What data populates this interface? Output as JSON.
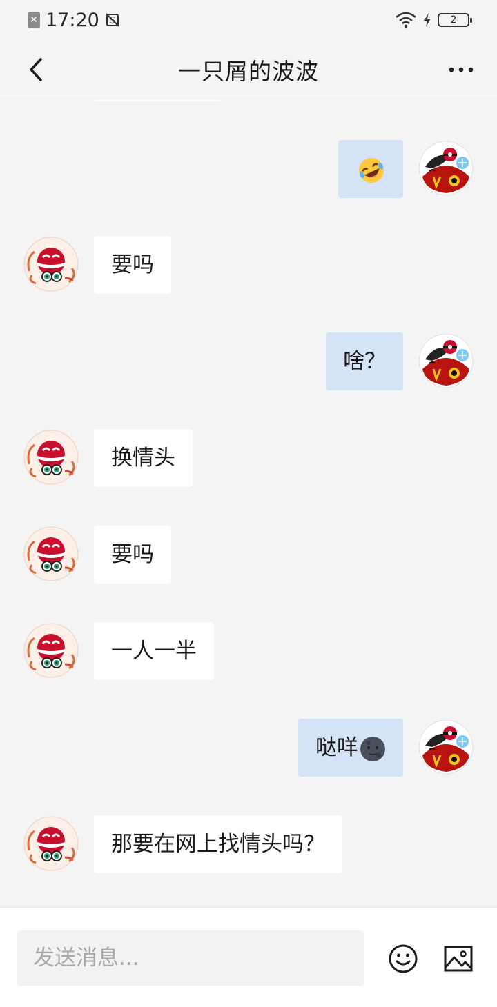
{
  "status_bar": {
    "time": "17:20",
    "battery_level": "2",
    "icons": [
      "sim-off-icon",
      "screenshot-icon",
      "wifi-icon",
      "charging-icon",
      "battery-icon"
    ]
  },
  "nav": {
    "title": "一只屑的波波",
    "back_icon": "chevron-left-icon",
    "more_icon": "more-dots-icon"
  },
  "messages": [
    {
      "direction": "out",
      "text": "",
      "emoji": "rolling-laughing-emoji"
    },
    {
      "direction": "in",
      "text": "要吗"
    },
    {
      "direction": "out",
      "text": "啥？"
    },
    {
      "direction": "in",
      "text": "换情头"
    },
    {
      "direction": "in",
      "text": "要吗"
    },
    {
      "direction": "in",
      "text": "一人一半"
    },
    {
      "direction": "out",
      "text": "哒咩",
      "emoji": "new-moon-face-emoji"
    },
    {
      "direction": "in",
      "text": "那要在网上找情头吗？"
    }
  ],
  "input": {
    "placeholder": "发送消息...",
    "value": ""
  },
  "toolbar": {
    "emoji_icon": "smiley-icon",
    "image_icon": "image-icon"
  },
  "colors": {
    "background": "#f4f4f5",
    "incoming_bubble": "#ffffff",
    "outgoing_bubble": "#d4e3f5"
  }
}
